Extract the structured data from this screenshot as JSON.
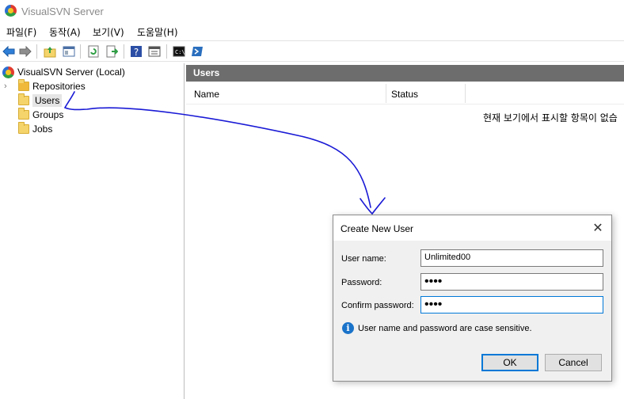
{
  "window": {
    "title": "VisualSVN Server"
  },
  "menu": [
    "파일(F)",
    "동작(A)",
    "보기(V)",
    "도움말(H)"
  ],
  "toolbar": {
    "icons": [
      "back-arrow-icon",
      "forward-arrow-icon",
      "up-folder-icon",
      "show-hide-tree-icon",
      "refresh-icon",
      "export-list-icon",
      "help-icon",
      "properties-icon",
      "console-icon",
      "powershell-icon"
    ]
  },
  "tree": {
    "root": "VisualSVN Server (Local)",
    "items": [
      "Repositories",
      "Users",
      "Groups",
      "Jobs"
    ]
  },
  "main": {
    "header": "Users",
    "columns": [
      "Name",
      "Status"
    ],
    "empty_message": "현재 보기에서 표시할 항목이 없습"
  },
  "dialog": {
    "title": "Create New User",
    "close": "✕",
    "fields": {
      "username_label": "User name:",
      "username_value": "Unlimited00",
      "password_label": "Password:",
      "password_value": "••••",
      "confirm_label": "Confirm password:",
      "confirm_value": "••••"
    },
    "info_icon": "i",
    "info": "User name and password are case sensitive.",
    "ok": "OK",
    "cancel": "Cancel"
  },
  "colors": {
    "accent": "#0078d7",
    "annotation": "#1a1ad6",
    "header": "#6d6d6d"
  }
}
